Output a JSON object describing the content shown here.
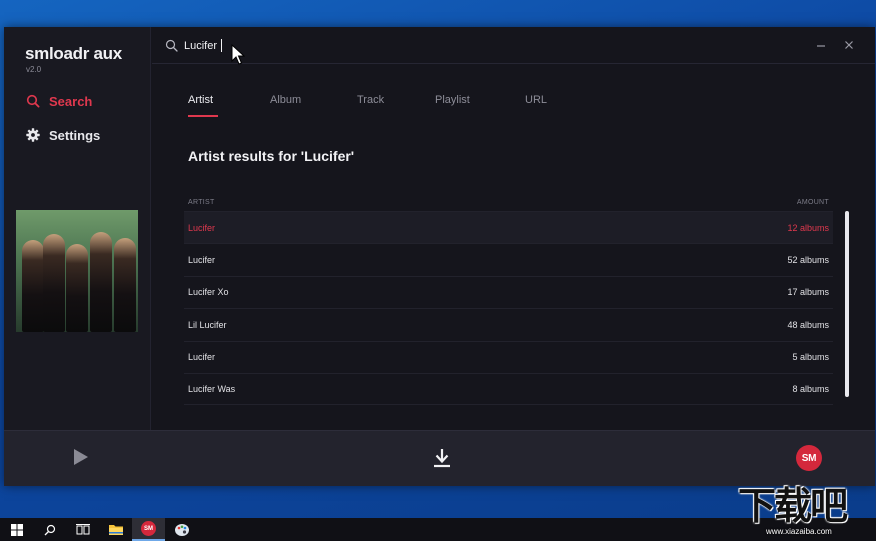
{
  "app": {
    "name": "smloadr aux",
    "version": "v2.0"
  },
  "sidebar": {
    "items": [
      {
        "label": "Search",
        "icon": "search-icon"
      },
      {
        "label": "Settings",
        "icon": "gear-icon"
      }
    ]
  },
  "search": {
    "value": "Lucifer",
    "placeholder": ""
  },
  "tabs": [
    {
      "label": "Artist",
      "active": true
    },
    {
      "label": "Album",
      "active": false
    },
    {
      "label": "Track",
      "active": false
    },
    {
      "label": "Playlist",
      "active": false
    },
    {
      "label": "URL",
      "active": false
    }
  ],
  "results": {
    "heading": "Artist results for 'Lucifer'",
    "columns": {
      "artist": "ARTIST",
      "amount": "AMOUNT"
    },
    "rows": [
      {
        "artist": "Lucifer",
        "amount": "12 albums"
      },
      {
        "artist": "Lucifer",
        "amount": "52 albums"
      },
      {
        "artist": "Lucifer Xo",
        "amount": "17 albums"
      },
      {
        "artist": "Lil Lucifer",
        "amount": "48 albums"
      },
      {
        "artist": "Lucifer",
        "amount": "5 albums"
      },
      {
        "artist": "Lucifer Was",
        "amount": "8 albums"
      }
    ],
    "selected_index": 0
  },
  "player": {
    "avatar_text": "SM"
  },
  "taskbar": {
    "sm_icon_text": "SM"
  },
  "watermark": {
    "text": "下载吧",
    "url": "www.xiazaiba.com"
  },
  "colors": {
    "accent": "#e0384e",
    "background": "#15151c",
    "sidebar": "#191921",
    "player": "#23232d"
  }
}
